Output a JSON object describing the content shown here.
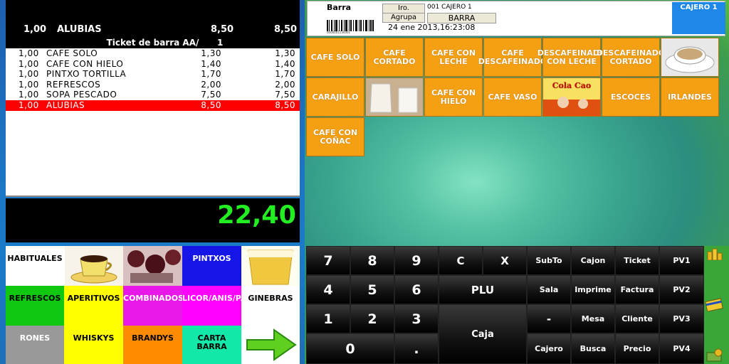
{
  "ticket": {
    "top_line": {
      "qty": "1,00",
      "name": "ALUBIAS",
      "price": "8,50",
      "total": "8,50"
    },
    "header": "Ticket de barra AA/",
    "header_num": "1",
    "lines": [
      {
        "qty": "1,00",
        "name": "CAFE SOLO",
        "price": "1,30",
        "total": "1,30"
      },
      {
        "qty": "1,00",
        "name": "CAFE CON HIELO",
        "price": "1,40",
        "total": "1,40"
      },
      {
        "qty": "1,00",
        "name": "PINTXO TORTILLA",
        "price": "1,70",
        "total": "1,70"
      },
      {
        "qty": "1,00",
        "name": "REFRESCOS",
        "price": "2,00",
        "total": "2,00"
      },
      {
        "qty": "1,00",
        "name": "SOPA PESCADO",
        "price": "7,50",
        "total": "7,50"
      },
      {
        "qty": "1,00",
        "name": "ALUBIAS",
        "price": "8,50",
        "total": "8,50"
      }
    ],
    "total": "22,40"
  },
  "categories": [
    {
      "label": "HABITUALES",
      "bg": "#ffffff",
      "color": "#000000"
    },
    {
      "label": "",
      "bg": "#ffffff",
      "icon": "coffee-cup-image"
    },
    {
      "label": "",
      "bg": "#ffffff",
      "icon": "wine-glasses-image"
    },
    {
      "label": "PINTXOS",
      "bg": "#1515e8",
      "color": "#ffffff"
    },
    {
      "label": "",
      "bg": "#ffffff",
      "icon": "beer-glass-image"
    },
    {
      "label": "REFRESCOS",
      "bg": "#10c810",
      "color": "#000000"
    },
    {
      "label": "APERITIVOS",
      "bg": "#ffff00",
      "color": "#000000"
    },
    {
      "label": "COMBINADOS",
      "bg": "#e818e8",
      "color": "#ffffff"
    },
    {
      "label": "LICOR/ANIS/PATXARAN",
      "bg": "#ff00ff",
      "color": "#ffffff"
    },
    {
      "label": "GINEBRAS",
      "bg": "#ffffff",
      "color": "#000000"
    },
    {
      "label": "RONES",
      "bg": "#999999",
      "color": "#ffffff"
    },
    {
      "label": "WHISKYS",
      "bg": "#ffff00",
      "color": "#000000"
    },
    {
      "label": "BRANDYS",
      "bg": "#ff8c00",
      "color": "#000000"
    },
    {
      "label": "CARTA BARRA",
      "bg": "#12e8a8",
      "color": "#000000"
    },
    {
      "label": "",
      "bg": "#ffffff",
      "icon": "arrow-right-icon"
    }
  ],
  "header": {
    "section": "Barra",
    "irio_btn": "Iro.",
    "agrupa_btn": "Agrupa",
    "cashier_line": "001 CAJERO 1",
    "barra_btn": "BARRA",
    "datetime": "24 ene 2013,16:23:08",
    "cajero_box": "CAJERO 1",
    "barcode_text": "0000001230001"
  },
  "products": [
    {
      "label": "CAFE SOLO"
    },
    {
      "label": "CAFE CORTADO"
    },
    {
      "label": "CAFE CON LECHE"
    },
    {
      "label": "CAFE DESCAFEINADO"
    },
    {
      "label": "DESCAFEINADO CON LECHE"
    },
    {
      "label": "DESCAFEINADO CORTADO"
    },
    {
      "label": "",
      "icon": "coffee-cup-image"
    },
    {
      "label": "CARAJILLO"
    },
    {
      "label": "",
      "icon": "milk-jug-image"
    },
    {
      "label": "CAFE CON HIELO"
    },
    {
      "label": "CAFE VASO"
    },
    {
      "label": "",
      "icon": "cola-cao-image",
      "brand": "Cola Cao"
    },
    {
      "label": "ESCOCES"
    },
    {
      "label": "IRLANDES"
    },
    {
      "label": "CAFE CON COÑAC"
    }
  ],
  "keypad": {
    "k7": "7",
    "k8": "8",
    "k9": "9",
    "kc": "C",
    "kx": "X",
    "k4": "4",
    "k5": "5",
    "k6": "6",
    "plu": "PLU",
    "k1": "1",
    "k2": "2",
    "k3": "3",
    "caja": "Caja",
    "k0": "0",
    "kdot": ".",
    "subto": "SubTo",
    "cajon": "Cajon",
    "ticket": "Ticket",
    "pv1": "PV1",
    "sala": "Sala",
    "imprime": "Imprime",
    "factura": "Factura",
    "pv2": "PV2",
    "minus": "-",
    "mesa": "Mesa",
    "cliente": "Cliente",
    "pv3": "PV3",
    "cajero": "Cajero",
    "busca": "Busca",
    "precio": "Precio",
    "pv4": "PV4"
  },
  "colors": {
    "product_bg": "#f5a012",
    "total_text": "#22ee22",
    "selected_row": "#ff0000"
  }
}
